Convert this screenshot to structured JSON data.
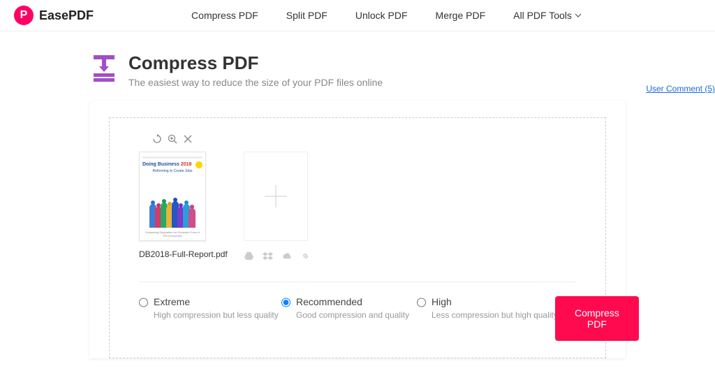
{
  "brand": {
    "logo_letter": "P",
    "name": "EasePDF"
  },
  "nav": {
    "items": [
      {
        "label": "Compress PDF"
      },
      {
        "label": "Split PDF"
      },
      {
        "label": "Unlock PDF"
      },
      {
        "label": "Merge PDF"
      }
    ],
    "more": {
      "label": "All PDF Tools"
    }
  },
  "hero": {
    "title": "Compress PDF",
    "subtitle": "The easiest way to reduce the size of your PDF files online",
    "user_comment": "User Comment (5)"
  },
  "files": [
    {
      "name": "DB2018-Full-Report.pdf",
      "thumb_title": "Doing Business",
      "thumb_year": "2018",
      "thumb_subtitle": "Reforming to Create Jobs",
      "thumb_footer": "Comparing Regulation for Domestic Firms in 190 Economies"
    }
  ],
  "options": [
    {
      "key": "extreme",
      "title": "Extreme",
      "desc": "High compression but less quality",
      "selected": false
    },
    {
      "key": "recommended",
      "title": "Recommended",
      "desc": "Good compression and quality",
      "selected": true
    },
    {
      "key": "high",
      "title": "High",
      "desc": "Less compression but high quality",
      "selected": false
    }
  ],
  "action_label": "Compress PDF",
  "cloud_sources": [
    "google-drive-icon",
    "dropbox-icon",
    "onedrive-icon",
    "url-link-icon"
  ]
}
